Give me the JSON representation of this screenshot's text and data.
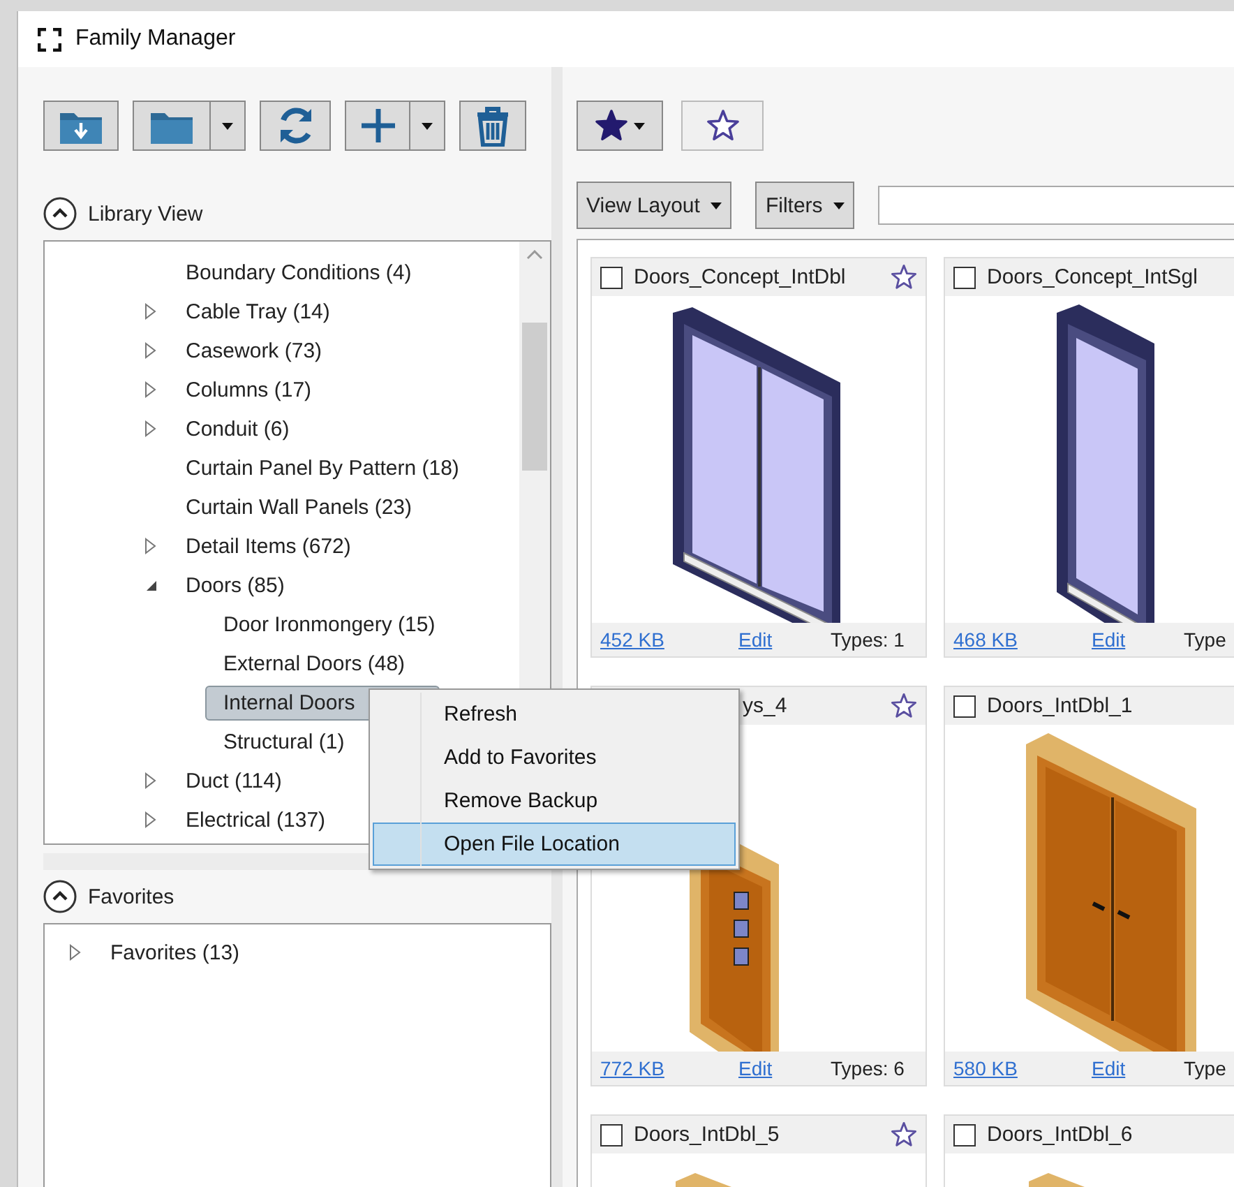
{
  "window": {
    "title": "Family Manager"
  },
  "library_view": {
    "title": "Library View",
    "tree": [
      {
        "label": "Boundary Conditions (4)",
        "selected": false
      },
      {
        "label": "Cable Tray (14)",
        "expanded": false,
        "selected": false
      },
      {
        "label": "Casework (73)",
        "expanded": false,
        "selected": false
      },
      {
        "label": "Columns (17)",
        "expanded": false,
        "selected": false
      },
      {
        "label": "Conduit (6)",
        "expanded": false,
        "selected": false
      },
      {
        "label": "Curtain Panel By Pattern (18)",
        "selected": false
      },
      {
        "label": "Curtain Wall Panels (23)",
        "selected": false
      },
      {
        "label": "Detail Items (672)",
        "expanded": false,
        "selected": false
      },
      {
        "label": "Doors (85)",
        "expanded": true,
        "selected": false,
        "children": [
          {
            "label": "Door Ironmongery (15)",
            "selected": false
          },
          {
            "label": "External Doors (48)",
            "selected": false
          },
          {
            "label": "Internal Doors",
            "selected": true
          },
          {
            "label": "Structural (1)",
            "selected": false
          }
        ]
      },
      {
        "label": "Duct (114)",
        "expanded": false,
        "selected": false
      },
      {
        "label": "Electrical (137)",
        "expanded": false,
        "selected": false
      }
    ]
  },
  "favorites": {
    "title": "Favorites",
    "tree": [
      {
        "label": "Favorites (13)",
        "expanded": false,
        "selected": false
      }
    ]
  },
  "view_controls": {
    "view_layout": "View Layout",
    "filters": "Filters"
  },
  "cards": [
    {
      "title": "Doors_Concept_IntDbl",
      "checked": false,
      "favorite": false,
      "kind": "glass-double",
      "size": "452 KB",
      "edit": "Edit",
      "types": "Types: 1"
    },
    {
      "title": "Doors_Concept_IntSgl",
      "checked": false,
      "kind": "glass-single",
      "size": "468 KB",
      "edit": "Edit",
      "types": "Type"
    },
    {
      "title": "ys_4",
      "covered": true,
      "favorite": false,
      "kind": "wood-single",
      "size": "772 KB",
      "edit": "Edit",
      "types": "Types: 6"
    },
    {
      "title": "Doors_IntDbl_1",
      "checked": false,
      "kind": "wood-double",
      "size": "580 KB",
      "edit": "Edit",
      "types": "Type"
    },
    {
      "title": "Doors_IntDbl_5",
      "checked": false,
      "favorite": false,
      "kind": "wood-top"
    },
    {
      "title": "Doors_IntDbl_6",
      "checked": false,
      "kind": "wood-top"
    }
  ],
  "context_menu": [
    {
      "label": "Refresh",
      "selected": false
    },
    {
      "label": "Add to Favorites",
      "selected": false
    },
    {
      "label": "Remove Backup",
      "selected": false
    },
    {
      "label": "Open File Location",
      "selected": true
    }
  ]
}
